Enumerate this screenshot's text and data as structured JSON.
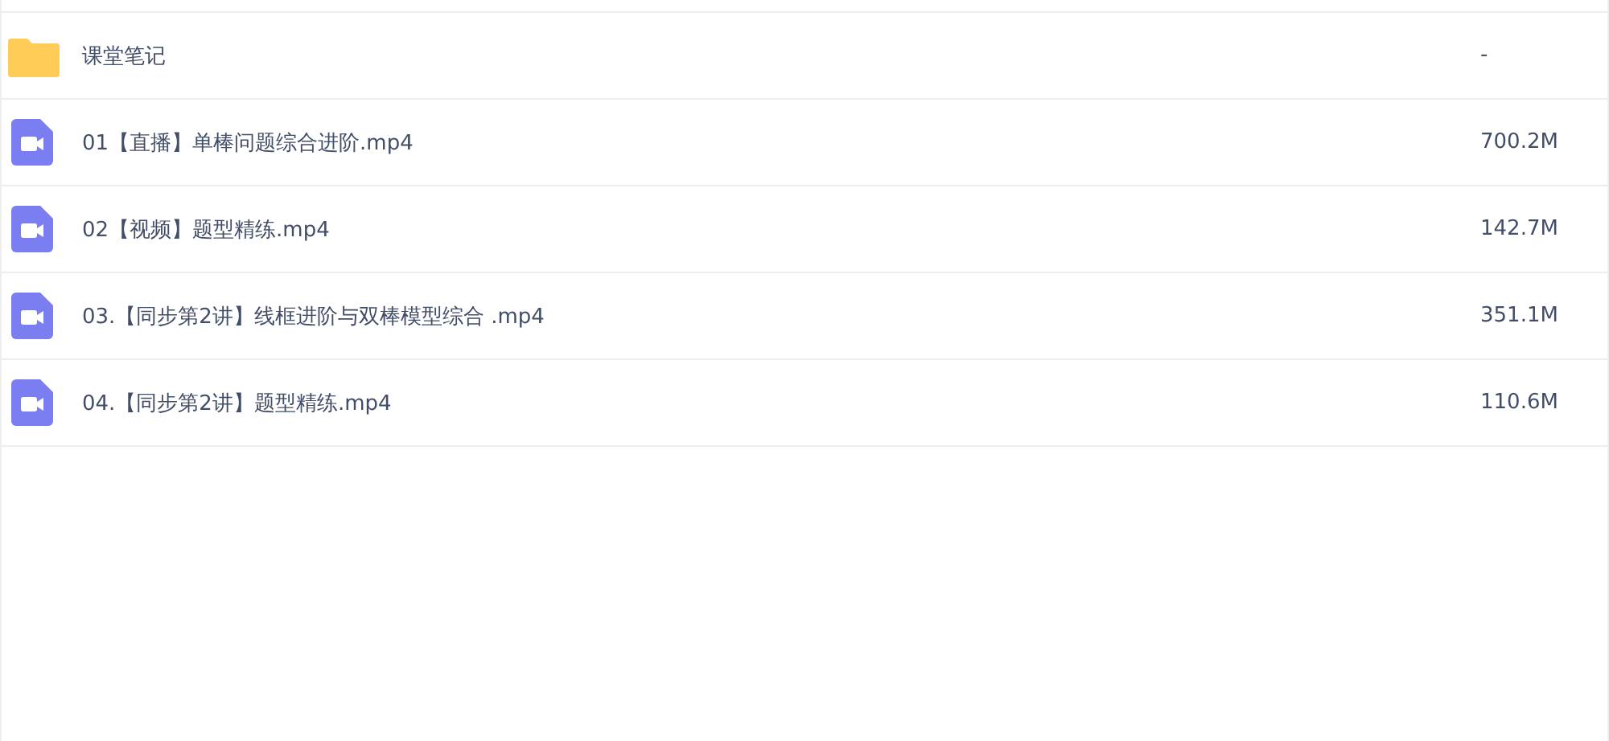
{
  "files": [
    {
      "kind": "folder",
      "name": "课堂笔记",
      "size": "-"
    },
    {
      "kind": "video",
      "name": "01【直播】单棒问题综合进阶.mp4",
      "size": "700.2M"
    },
    {
      "kind": "video",
      "name": "02【视频】题型精练.mp4",
      "size": "142.7M"
    },
    {
      "kind": "video",
      "name": "03.【同步第2讲】线框进阶与双棒模型综合 .mp4",
      "size": "351.1M"
    },
    {
      "kind": "video",
      "name": "04.【同步第2讲】题型精练.mp4",
      "size": "110.6M"
    }
  ]
}
